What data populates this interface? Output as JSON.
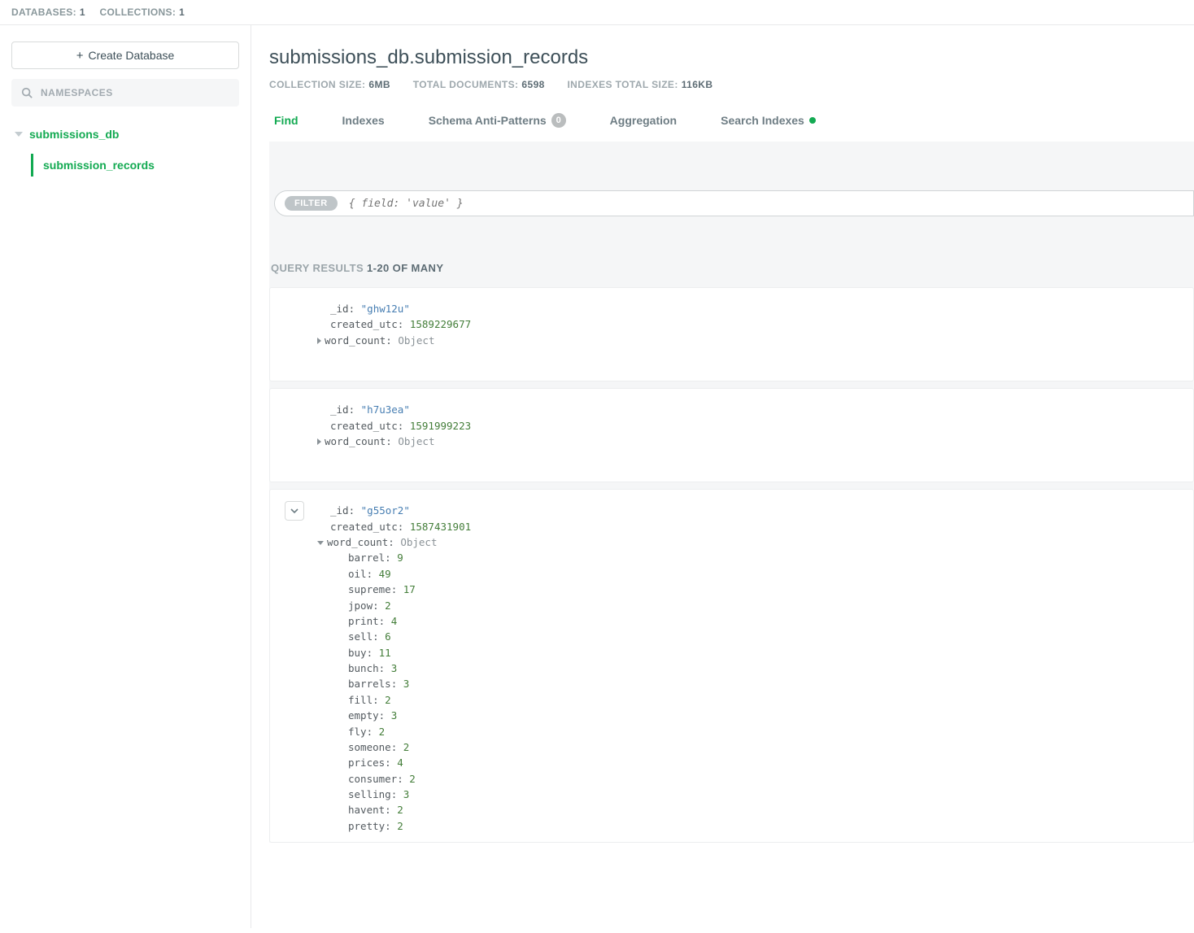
{
  "topbar": {
    "databases_label": "DATABASES:",
    "databases_count": "1",
    "collections_label": "COLLECTIONS:",
    "collections_count": "1"
  },
  "sidebar": {
    "create_db_label": "Create Database",
    "namespaces_label": "NAMESPACES",
    "db_name": "submissions_db",
    "collection_name": "submission_records"
  },
  "header": {
    "title": "submissions_db.submission_records",
    "coll_size_label": "COLLECTION SIZE:",
    "coll_size_val": "6MB",
    "docs_label": "TOTAL DOCUMENTS:",
    "docs_val": "6598",
    "idx_label": "INDEXES TOTAL SIZE:",
    "idx_val": "116KB"
  },
  "tabs": {
    "find": "Find",
    "indexes": "Indexes",
    "schema": "Schema Anti-Patterns",
    "schema_badge": "0",
    "aggregation": "Aggregation",
    "search_indexes": "Search Indexes"
  },
  "filter": {
    "chip": "FILTER",
    "placeholder": "{ field: 'value' }"
  },
  "results": {
    "label_prefix": "QUERY RESULTS",
    "label_range": "1-20 OF MANY"
  },
  "docs": [
    {
      "expanded": false,
      "_id": "\"ghw12u\"",
      "created_utc": "1589229677",
      "word_count_expanded": false
    },
    {
      "expanded": false,
      "_id": "\"h7u3ea\"",
      "created_utc": "1591999223",
      "word_count_expanded": false
    },
    {
      "expanded": true,
      "_id": "\"g55or2\"",
      "created_utc": "1587431901",
      "word_count_expanded": true,
      "word_count": [
        {
          "k": "barrel",
          "v": "9"
        },
        {
          "k": "oil",
          "v": "49"
        },
        {
          "k": "supreme",
          "v": "17"
        },
        {
          "k": "jpow",
          "v": "2"
        },
        {
          "k": "print",
          "v": "4"
        },
        {
          "k": "sell",
          "v": "6"
        },
        {
          "k": "buy",
          "v": "11"
        },
        {
          "k": "bunch",
          "v": "3"
        },
        {
          "k": "barrels",
          "v": "3"
        },
        {
          "k": "fill",
          "v": "2"
        },
        {
          "k": "empty",
          "v": "3"
        },
        {
          "k": "fly",
          "v": "2"
        },
        {
          "k": "someone",
          "v": "2"
        },
        {
          "k": "prices",
          "v": "4"
        },
        {
          "k": "consumer",
          "v": "2"
        },
        {
          "k": "selling",
          "v": "3"
        },
        {
          "k": "havent",
          "v": "2"
        },
        {
          "k": "pretty",
          "v": "2"
        }
      ]
    }
  ],
  "field_labels": {
    "_id": "_id",
    "created_utc": "created_utc",
    "word_count": "word_count",
    "object": "Object"
  }
}
